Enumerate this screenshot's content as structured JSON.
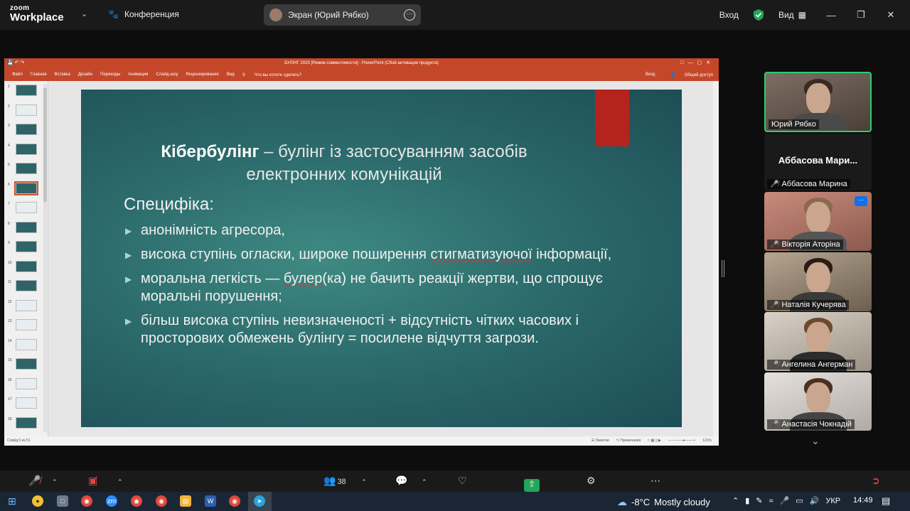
{
  "app": {
    "logo_line1": "zoom",
    "logo_line2": "Workplace",
    "conference_label": "Конференция",
    "share_label": "Экран (Юрий Рябко)",
    "enter_label": "Вход",
    "view_label": "Вид",
    "accent_green": "#23a55a",
    "ppt_red": "#c4472a"
  },
  "powerpoint": {
    "title_bar": "БУЛІНГ 2025 [Режим совместимости] - PowerPoint (Сбой активации продукта)",
    "ribbon_tabs": [
      "Файл",
      "Главная",
      "Вставка",
      "Дизайн",
      "Переходы",
      "Анимация",
      "Слайд-шоу",
      "Рецензирование",
      "Вид"
    ],
    "tell_me": "Что вы хотите сделать?",
    "sign_in": "Вход",
    "share": "Общий доступ",
    "thumbnail_numbers": [
      "1",
      "2",
      "3",
      "4",
      "5",
      "6",
      "7",
      "8",
      "9",
      "10",
      "11",
      "12",
      "13",
      "14",
      "15",
      "16",
      "17",
      "18"
    ],
    "selected_slide": "6",
    "status_left": "Слайд 6 из 51",
    "status_notes": "Заметки",
    "status_comments": "Примечания",
    "zoom_level": "121%"
  },
  "slide": {
    "title_bold": "Кібербулінг",
    "title_rest": " – булінг із застосуванням засобів",
    "title_line2": "електронних комунікацій",
    "subtitle": "Специфіка:",
    "bullets": [
      {
        "pre": "анонімність агресора,",
        "mark": "",
        "post": ""
      },
      {
        "pre": "висока ступінь огласки, широке поширення ",
        "mark": "стигматизуючої",
        "post": " інформації,"
      },
      {
        "pre": "моральна легкість — ",
        "mark": "булер",
        "post": "(ка) не бачить реакції жертви, що спрощує моральні порушення;"
      },
      {
        "pre": "більш висока ступінь невизначеності + відсутність чітких часових і просторових обмежень булінгу = посилене відчуття загрози.",
        "mark": "",
        "post": ""
      }
    ]
  },
  "participants": [
    {
      "name": "Юрий Рябко",
      "video": true,
      "speaking": true,
      "muted": false
    },
    {
      "name": "Аббасова Марина",
      "big_name": "Аббасова  Мари...",
      "video": false,
      "muted": true
    },
    {
      "name": "Вікторія Аторіна",
      "video": true,
      "muted": true
    },
    {
      "name": "Наталія Кучерява",
      "video": true,
      "muted": true
    },
    {
      "name": "Ангелина Ангерман",
      "video": true,
      "muted": true
    },
    {
      "name": "Анастасія Чокнадій",
      "video": true,
      "muted": true
    }
  ],
  "controls": {
    "participants_count": "38"
  },
  "taskbar": {
    "temperature": "-8°C",
    "weather": "Mostly cloudy",
    "language": "УКР",
    "time": "14:49"
  }
}
